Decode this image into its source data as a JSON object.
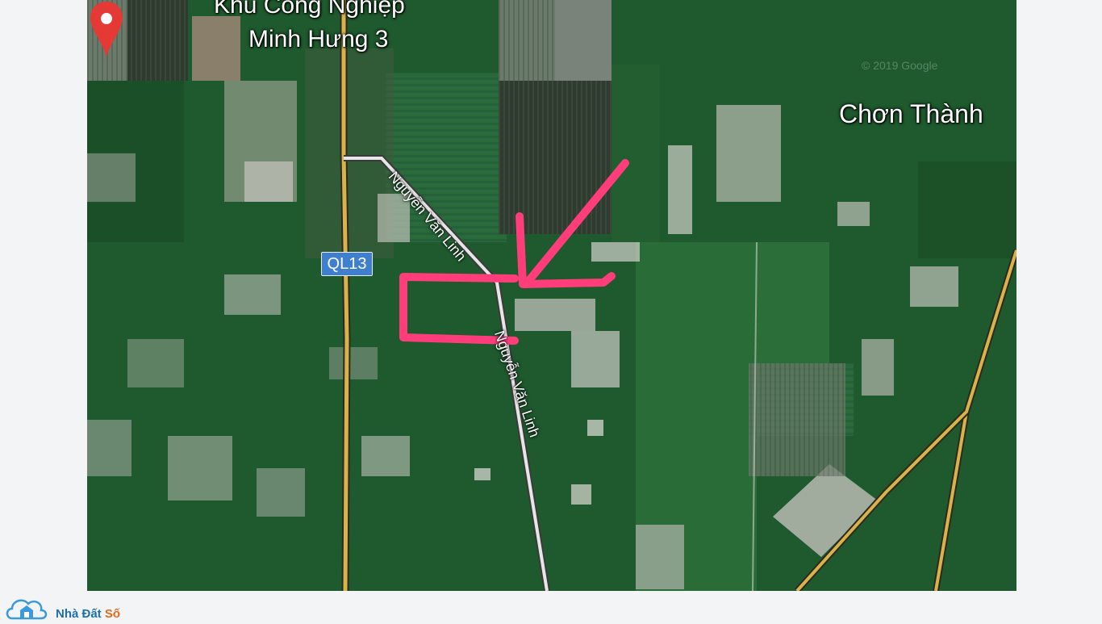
{
  "map": {
    "industrial_park_line1": "Khu Công Nghiệp",
    "industrial_park_line2": "Minh Hưng 3",
    "city_label": "Chơn Thành",
    "highway_shield": "QL13",
    "street_label_upper": "Nguyễn Văn Linh",
    "street_label_lower": "Nguyễn Văn Linh",
    "attribution": "© 2019 Google",
    "colors": {
      "vegetation": "#1f5a2c",
      "highway": "#d9b24a",
      "annotation": "#ff3d7a",
      "pin": "#e53935",
      "shield": "#3f7fcf"
    }
  },
  "brand": {
    "name": "Nhà Đất",
    "name_suffix": "Số",
    "icon": "house-cloud-icon"
  }
}
